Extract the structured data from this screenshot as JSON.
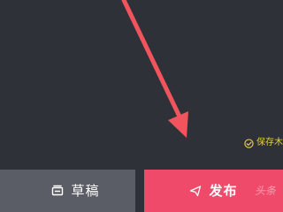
{
  "save_hint": {
    "label": "保存木",
    "icon": "check-circle-icon",
    "color": "#e5c94d"
  },
  "bottom_bar": {
    "draft_button": {
      "label": "草稿",
      "icon": "drafts-box-icon",
      "color": "#5a5d65"
    },
    "publish_button": {
      "label": "发布",
      "icon": "send-icon",
      "color": "#f04a6b"
    }
  },
  "annotation": {
    "arrow_color": "#f2545d"
  },
  "watermark": {
    "label": "头条"
  }
}
